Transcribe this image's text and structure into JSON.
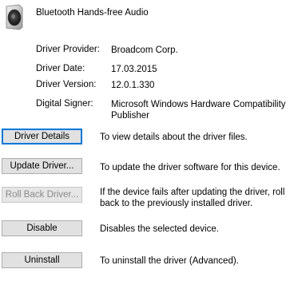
{
  "device": {
    "name": "Bluetooth Hands-free Audio",
    "icon": "speaker-icon"
  },
  "info": [
    {
      "label": "Driver Provider:",
      "value": "Broadcom Corp."
    },
    {
      "label": "Driver Date:",
      "value": "17.03.2015"
    },
    {
      "label": "Driver Version:",
      "value": "12.0.1.330"
    },
    {
      "label": "Digital Signer:",
      "value": "Microsoft Windows Hardware Compatibility Publisher"
    }
  ],
  "buttons": [
    {
      "label": "Driver Details",
      "description": "To view details about the driver files.",
      "enabled": true,
      "default": true
    },
    {
      "label": "Update Driver...",
      "description": "To update the driver software for this device.",
      "enabled": true
    },
    {
      "label": "Roll Back Driver...",
      "description": "If the device fails after updating the driver, roll back to the previously installed driver.",
      "enabled": false
    },
    {
      "label": "Disable",
      "description": "Disables the selected device.",
      "enabled": true
    },
    {
      "label": "Uninstall",
      "description": "To uninstall the driver (Advanced).",
      "enabled": true
    }
  ],
  "colors": {
    "focus_border": "#0078d7",
    "button_face": "#e1e1e1",
    "disabled_text": "#8a8a8a"
  }
}
